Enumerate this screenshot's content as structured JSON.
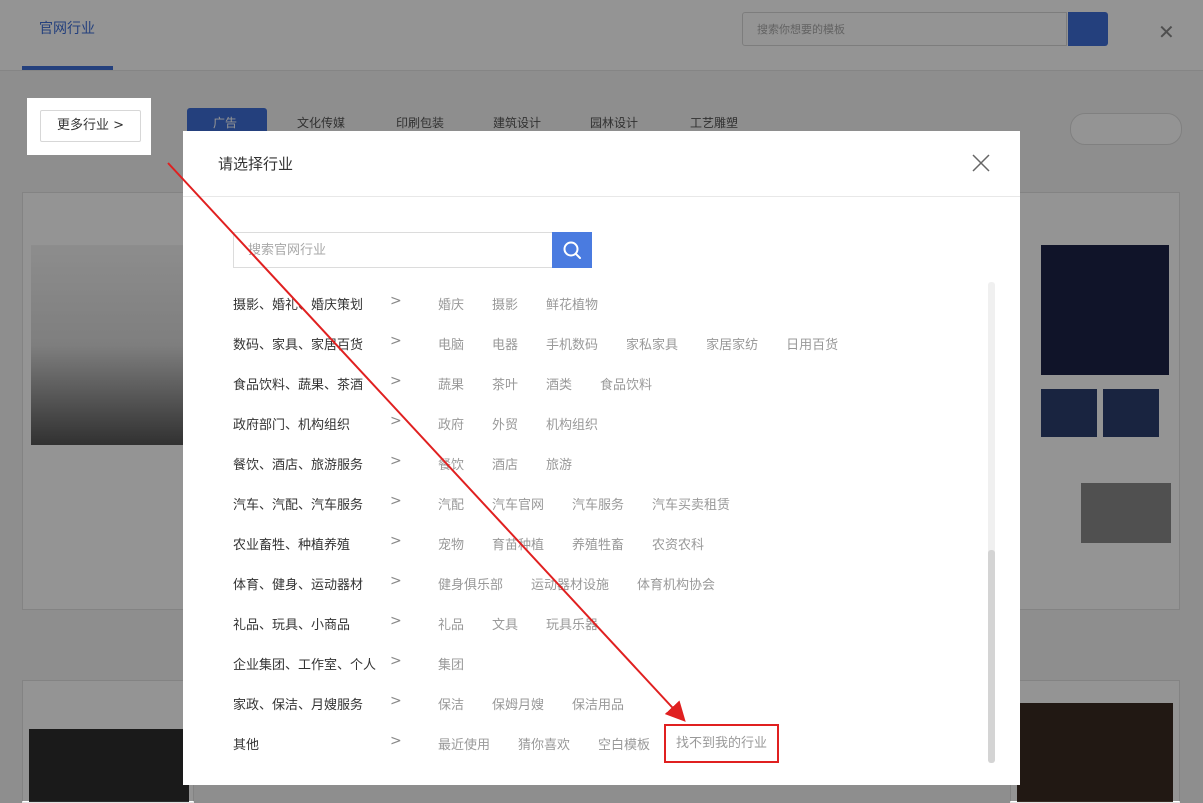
{
  "background": {
    "header_tab": "官网行业",
    "search_placeholder": "搜索你想要的模板",
    "categories": [
      "广告",
      "文化传媒",
      "印刷包装",
      "建筑设计",
      "园林设计",
      "工艺雕塑"
    ]
  },
  "more_button": {
    "label": "更多行业 >"
  },
  "dialog": {
    "title": "请选择行业",
    "search_placeholder": "搜索官网行业",
    "rows": [
      {
        "label": "摄影、婚礼、婚庆策划",
        "tags": [
          "婚庆",
          "摄影",
          "鲜花植物"
        ]
      },
      {
        "label": "数码、家具、家居百货",
        "tags": [
          "电脑",
          "电器",
          "手机数码",
          "家私家具",
          "家居家纺",
          "日用百货"
        ]
      },
      {
        "label": "食品饮料、蔬果、茶酒",
        "tags": [
          "蔬果",
          "茶叶",
          "酒类",
          "食品饮料"
        ]
      },
      {
        "label": "政府部门、机构组织",
        "tags": [
          "政府",
          "外贸",
          "机构组织"
        ]
      },
      {
        "label": "餐饮、酒店、旅游服务",
        "tags": [
          "餐饮",
          "酒店",
          "旅游"
        ]
      },
      {
        "label": "汽车、汽配、汽车服务",
        "tags": [
          "汽配",
          "汽车官网",
          "汽车服务",
          "汽车买卖租赁"
        ]
      },
      {
        "label": "农业畜牲、种植养殖",
        "tags": [
          "宠物",
          "育苗种植",
          "养殖牲畜",
          "农资农科"
        ]
      },
      {
        "label": "体育、健身、运动器材",
        "tags": [
          "健身俱乐部",
          "运动器材设施",
          "体育机构协会"
        ]
      },
      {
        "label": "礼品、玩具、小商品",
        "tags": [
          "礼品",
          "文具",
          "玩具乐器"
        ]
      },
      {
        "label": "企业集团、工作室、个人",
        "tags": [
          "集团"
        ]
      },
      {
        "label": "家政、保洁、月嫂服务",
        "tags": [
          "保洁",
          "保姆月嫂",
          "保洁用品"
        ]
      },
      {
        "label": "其他",
        "tags": [
          "最近使用",
          "猜你喜欢",
          "空白模板",
          "找不到我的行业"
        ]
      }
    ],
    "row_chevron": ">"
  },
  "colors": {
    "accent": "#4a7be0",
    "annotation_red": "#e02020",
    "tag_text": "#999999",
    "label_text": "#333333"
  },
  "icons": {
    "search": "search-icon",
    "close": "close-icon",
    "chevron": "chevron-right-icon"
  }
}
